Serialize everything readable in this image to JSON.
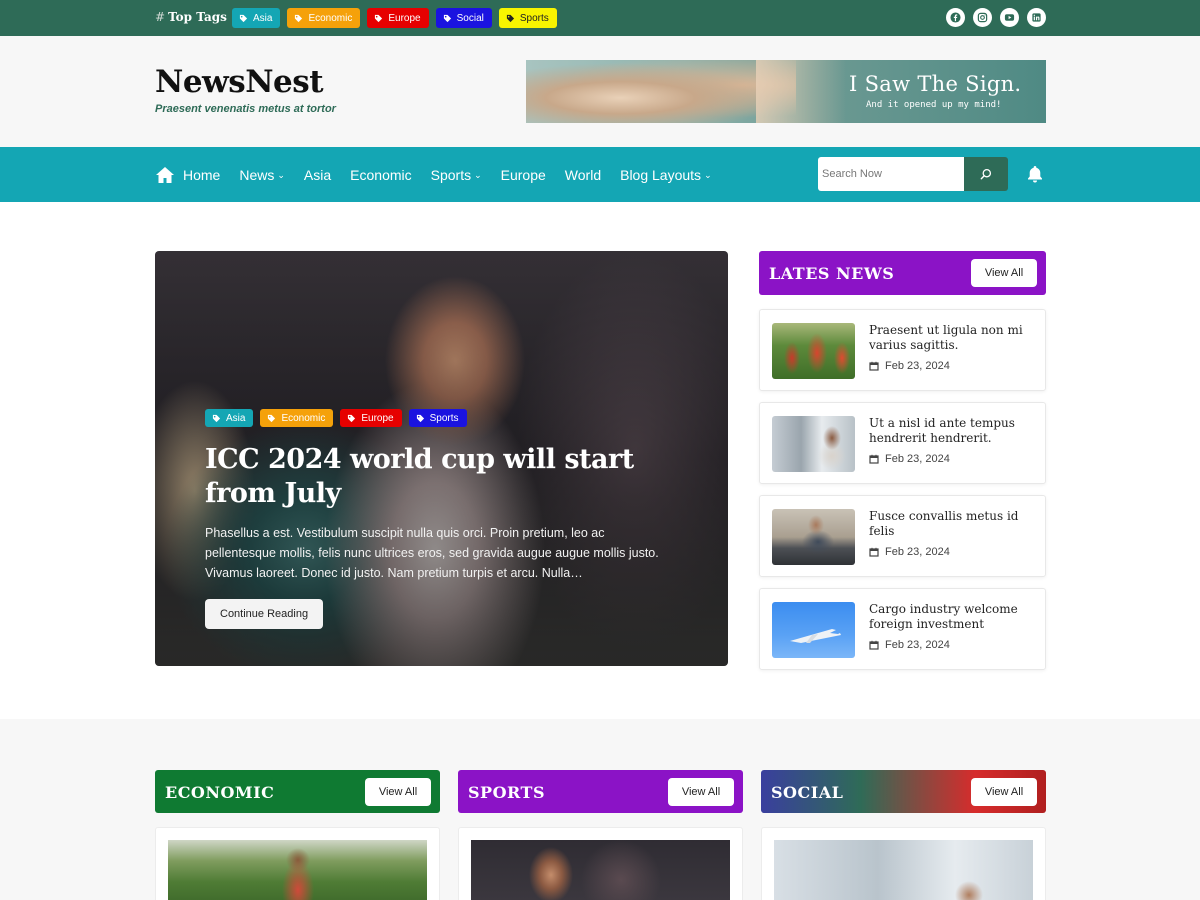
{
  "top_tags": {
    "label": "Top Tags",
    "hash": "#",
    "tags": [
      {
        "label": "Asia",
        "color": "#14a6b4"
      },
      {
        "label": "Economic",
        "color": "#f5a10a"
      },
      {
        "label": "Europe",
        "color": "#e60000"
      },
      {
        "label": "Social",
        "color": "#1a13e0"
      },
      {
        "label": "Sports",
        "color": "#f8f400"
      }
    ],
    "socials": [
      "facebook-icon",
      "instagram-icon",
      "youtube-icon",
      "linkedin-icon"
    ]
  },
  "header": {
    "site_title": "NewsNest",
    "tagline": "Praesent venenatis metus at tortor",
    "banner": {
      "title": "I Saw The Sign.",
      "subtitle": "And it opened up my mind!"
    }
  },
  "nav": {
    "items": [
      {
        "label": "Home",
        "icon": "home-icon"
      },
      {
        "label": "News",
        "dropdown": true
      },
      {
        "label": "Asia"
      },
      {
        "label": "Economic"
      },
      {
        "label": "Sports",
        "dropdown": true
      },
      {
        "label": "Europe"
      },
      {
        "label": "World"
      },
      {
        "label": "Blog Layouts",
        "dropdown": true
      }
    ],
    "search_placeholder": "Search Now",
    "accent": "#14a6b4"
  },
  "hero": {
    "tags": [
      {
        "label": "Asia",
        "color": "#14a6b4"
      },
      {
        "label": "Economic",
        "color": "#f5a10a"
      },
      {
        "label": "Europe",
        "color": "#e60000"
      },
      {
        "label": "Sports",
        "color": "#1a13e0"
      }
    ],
    "title": "ICC 2024 world cup will start from July",
    "excerpt": "Phasellus a est. Vestibulum suscipit nulla quis orci. Proin pretium, leo ac pellentesque mollis, felis nunc ultrices eros, sed gravida augue augue mollis justo. Vivamus laoreet. Donec id justo. Nam pretium turpis et arcu. Nulla…",
    "button": "Continue Reading"
  },
  "latest": {
    "title": "LATES NEWS",
    "view_all": "View All",
    "color": "#8b13c6",
    "items": [
      {
        "title": "Praesent ut ligula non mi varius sagittis.",
        "date": "Feb 23, 2024"
      },
      {
        "title": "Ut a nisl id ante tempus hendrerit hendrerit.",
        "date": "Feb 23, 2024"
      },
      {
        "title": "Fusce convallis metus id felis",
        "date": "Feb 23, 2024"
      },
      {
        "title": "Cargo industry welcome foreign investment",
        "date": "Feb 23, 2024"
      }
    ]
  },
  "categories": [
    {
      "title": "ECONOMIC",
      "view_all": "View All",
      "color": "#0f7a32"
    },
    {
      "title": "SPORTS",
      "view_all": "View All",
      "color": "#8b13c6"
    },
    {
      "title": "SOCIAL",
      "view_all": "View All",
      "color": "linear-gradient(90deg,#3a3f9e 0%,#2f6b57 35%,#d62c2c 75%,#b01f1f 100%)"
    }
  ]
}
